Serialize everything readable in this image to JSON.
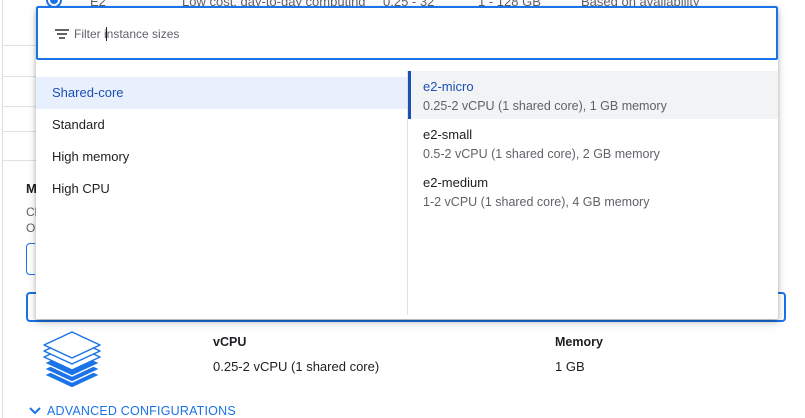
{
  "background": {
    "row_partial": {
      "series": "E2",
      "description": "Low cost, day-to-day computing",
      "vcpus": "0.25 - 32",
      "memory": "1 - 128 GB",
      "availability": "Based on availability"
    },
    "section_heading_trunc": "M",
    "section_text_trunc_1": "Ch",
    "section_text_trunc_2": "Or"
  },
  "dropdown": {
    "filter_placeholder": "Filter instance sizes",
    "filter_value": "",
    "categories": [
      {
        "label": "Shared-core",
        "selected": true
      },
      {
        "label": "Standard",
        "selected": false
      },
      {
        "label": "High memory",
        "selected": false
      },
      {
        "label": "High CPU",
        "selected": false
      }
    ],
    "sizes": [
      {
        "name": "e2-micro",
        "desc": "0.25-2 vCPU (1 shared core), 1 GB memory",
        "selected": true
      },
      {
        "name": "e2-small",
        "desc": "0.5-2 vCPU (1 shared core), 2 GB memory",
        "selected": false
      },
      {
        "name": "e2-medium",
        "desc": "1-2 vCPU (1 shared core), 4 GB memory",
        "selected": false
      }
    ]
  },
  "summary": {
    "vcpu_label": "vCPU",
    "vcpu_value": "0.25-2 vCPU (1 shared core)",
    "memory_label": "Memory",
    "memory_value": "1 GB"
  },
  "advanced_link": "ADVANCED CONFIGURATIONS",
  "colors": {
    "accent": "#1a73e8",
    "selected_text": "#1a4fb5",
    "selected_bg": "#e8f0fe"
  },
  "icons": {
    "filter": "filter-list-icon",
    "stack": "layers-stack-icon",
    "chevron": "chevron-down-icon"
  }
}
